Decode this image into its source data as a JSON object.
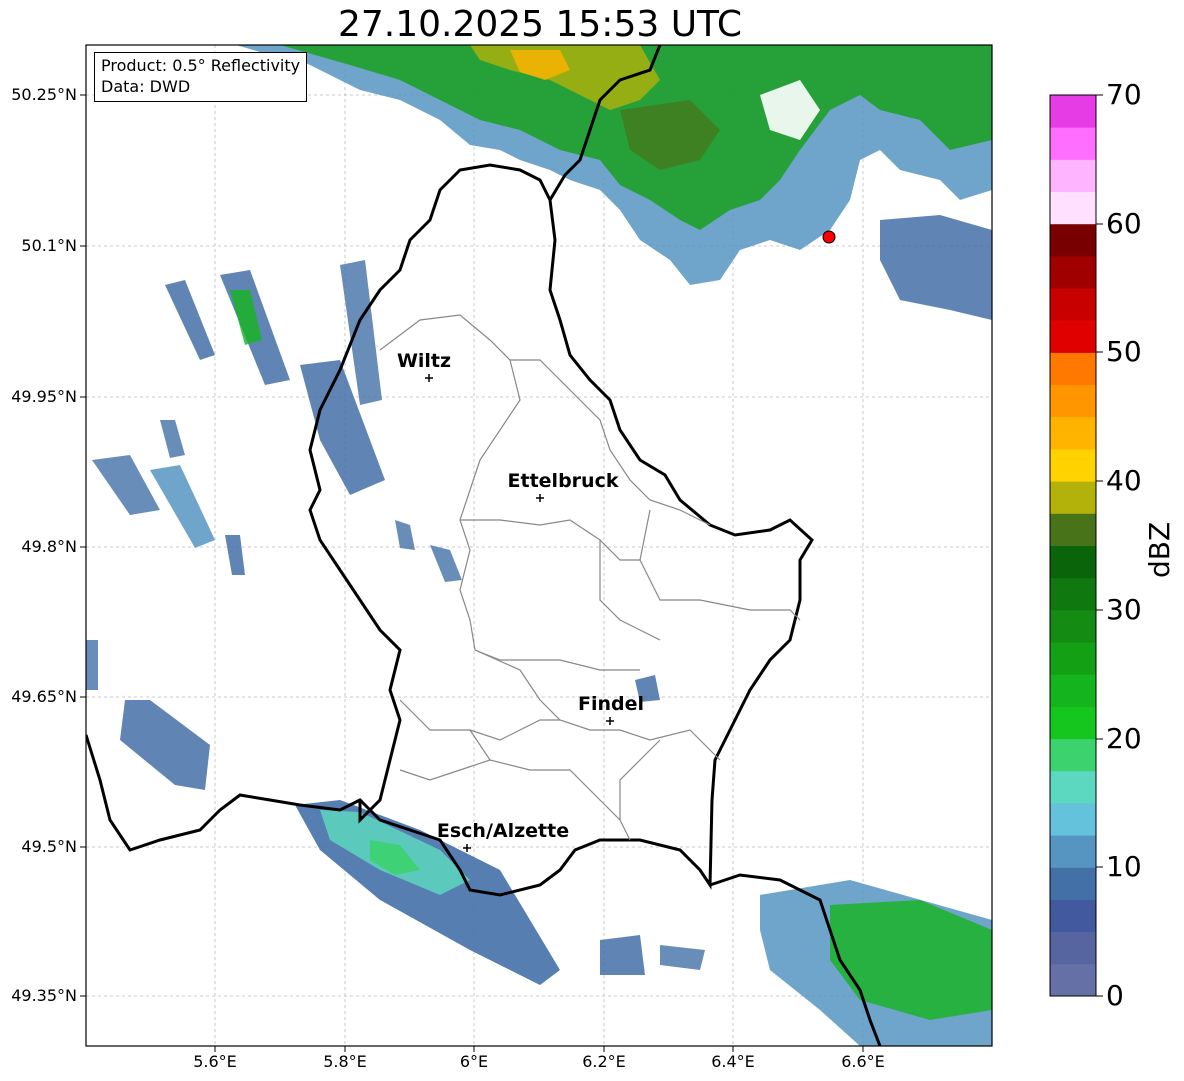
{
  "title": "27.10.2025 15:53 UTC",
  "info": {
    "product": "Product: 0.5° Reflectivity",
    "source": "Data: DWD"
  },
  "axes": {
    "lat_labels": [
      "50.25°N",
      "50.1°N",
      "49.95°N",
      "49.8°N",
      "49.65°N",
      "49.5°N",
      "49.35°N"
    ],
    "lon_labels": [
      "5.6°E",
      "5.8°E",
      "6°E",
      "6.2°E",
      "6.4°E",
      "6.6°E"
    ]
  },
  "cities": [
    {
      "name": "Wiltz",
      "lon": 5.93,
      "lat": 49.967
    },
    {
      "name": "Ettelbruck",
      "lon": 6.1,
      "lat": 49.847
    },
    {
      "name": "Findel",
      "lon": 6.21,
      "lat": 49.627
    },
    {
      "name": "Esch/Alzette",
      "lon": 5.98,
      "lat": 49.5
    }
  ],
  "colorbar": {
    "unit": "dBZ",
    "ticks": [
      "0",
      "10",
      "20",
      "30",
      "40",
      "50",
      "60",
      "70"
    ],
    "colors": [
      "#6571a6",
      "#5664a0",
      "#42599f",
      "#4470a8",
      "#5695c2",
      "#64c2dc",
      "#5cd7c0",
      "#3cd26e",
      "#14c61e",
      "#14b41e",
      "#14a014",
      "#148c14",
      "#0f780f",
      "#0a640a",
      "#487319",
      "#b2b20a",
      "#ffd200",
      "#ffb400",
      "#ff9600",
      "#ff7800",
      "#e10000",
      "#c80000",
      "#a00000",
      "#780000",
      "#ffe0ff",
      "#ffb4ff",
      "#ff6eff",
      "#e63ce6"
    ]
  },
  "marker": {
    "name": "radar-site",
    "lon": 6.55,
    "lat": 50.11,
    "color": "#ff0000"
  }
}
